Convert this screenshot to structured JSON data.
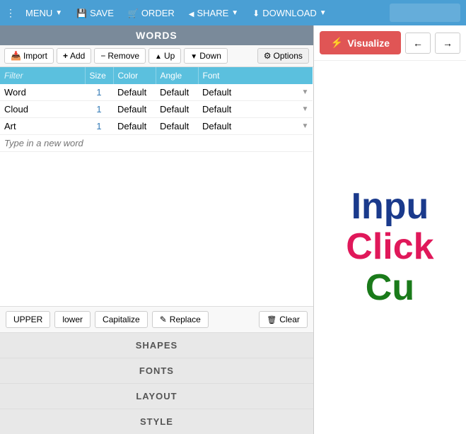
{
  "topnav": {
    "menu_label": "MENU",
    "save_label": "SAVE",
    "order_label": "ORDER",
    "share_label": "SHARE",
    "download_label": "DOWNLOAD"
  },
  "words_panel": {
    "header": "WORDS",
    "import_btn": "Import",
    "add_btn": "Add",
    "remove_btn": "Remove",
    "up_btn": "Up",
    "down_btn": "Down",
    "options_btn": "Options",
    "table": {
      "columns": [
        "Filter",
        "Size",
        "Color",
        "Angle",
        "Font"
      ],
      "rows": [
        {
          "word": "Word",
          "size": "1",
          "color": "Default",
          "angle": "Default",
          "font": "Default"
        },
        {
          "word": "Cloud",
          "size": "1",
          "color": "Default",
          "angle": "Default",
          "font": "Default"
        },
        {
          "word": "Art",
          "size": "1",
          "color": "Default",
          "angle": "Default",
          "font": "Default"
        }
      ],
      "new_word_placeholder": "Type in a new word"
    },
    "case_btns": [
      "UPPER",
      "lower",
      "Capitalize"
    ],
    "replace_btn": "Replace",
    "clear_btn": "Clear",
    "sections": [
      "SHAPES",
      "FONTS",
      "LAYOUT",
      "STYLE"
    ]
  },
  "visualize": {
    "btn_label": "Visualize",
    "preview_words": [
      "Inpu",
      "Click",
      "Cu"
    ]
  }
}
